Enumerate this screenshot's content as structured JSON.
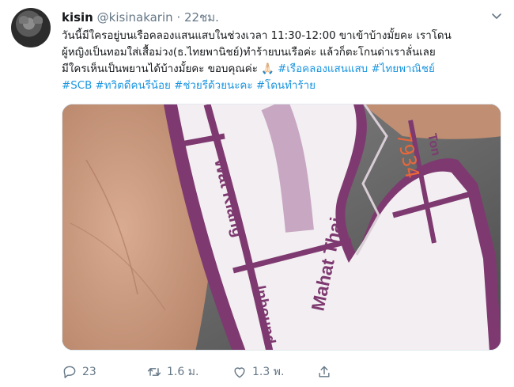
{
  "tweet": {
    "author_name": "kisin",
    "author_handle": "@kisinakarin",
    "separator": "·",
    "timestamp": "22ชม.",
    "lines": [
      [
        {
          "t": "วันนี้มีใครอยู่บนเรือคลองแสนแสบในช่วงเวลา 11:30-12:00 ขาเข้าบ้างมั้ยคะ เราโดน",
          "tag": false
        }
      ],
      [
        {
          "t": "ผู้หญิงเป็นทอมใส่เสื้อม่วง(ธ.ไทยพานิชย์)ทำร้ายบนเรือค่ะ แล้วก็ตะโกนด่าเราลั่นเลย",
          "tag": false
        }
      ],
      [
        {
          "t": "มีใครเห็นเป็นพยานได้บ้างมั้ยคะ ขอบคุณค่ะ 🙏🏻 ",
          "tag": false
        },
        {
          "t": "#เรือคลองแสนแสบ",
          "tag": true
        },
        {
          "t": " ",
          "tag": false
        },
        {
          "t": "#ไทยพาณิชย์",
          "tag": true
        }
      ],
      [
        {
          "t": "#SCB",
          "tag": true
        },
        {
          "t": " ",
          "tag": false
        },
        {
          "t": "#ทวิตดีคนรีน้อย",
          "tag": true
        },
        {
          "t": " ",
          "tag": false
        },
        {
          "t": "#ช่วยรีด้วยนะคะ",
          "tag": true
        },
        {
          "t": " ",
          "tag": false
        },
        {
          "t": "#โดนทำร้าย",
          "tag": true
        }
      ]
    ]
  },
  "media": {
    "ticket_texts": {
      "wat_klang": "Wat Klang",
      "mahat_thai": "Mahat Thai",
      "inbound": "Inbound",
      "ton": "Ton",
      "serial": "7934"
    },
    "colors": {
      "ticket_purple": "#7e3a70",
      "ticket_paper": "#f3eef2",
      "skin": "#c99a7f",
      "serial_orange": "#e8673a"
    }
  },
  "actions": {
    "reply_count": "23",
    "retweet_count": "1.6 ม.",
    "like_count": "1.3 พ.",
    "icons": [
      "reply-icon",
      "retweet-icon",
      "like-icon",
      "share-icon"
    ],
    "icon_color": "#657786"
  }
}
